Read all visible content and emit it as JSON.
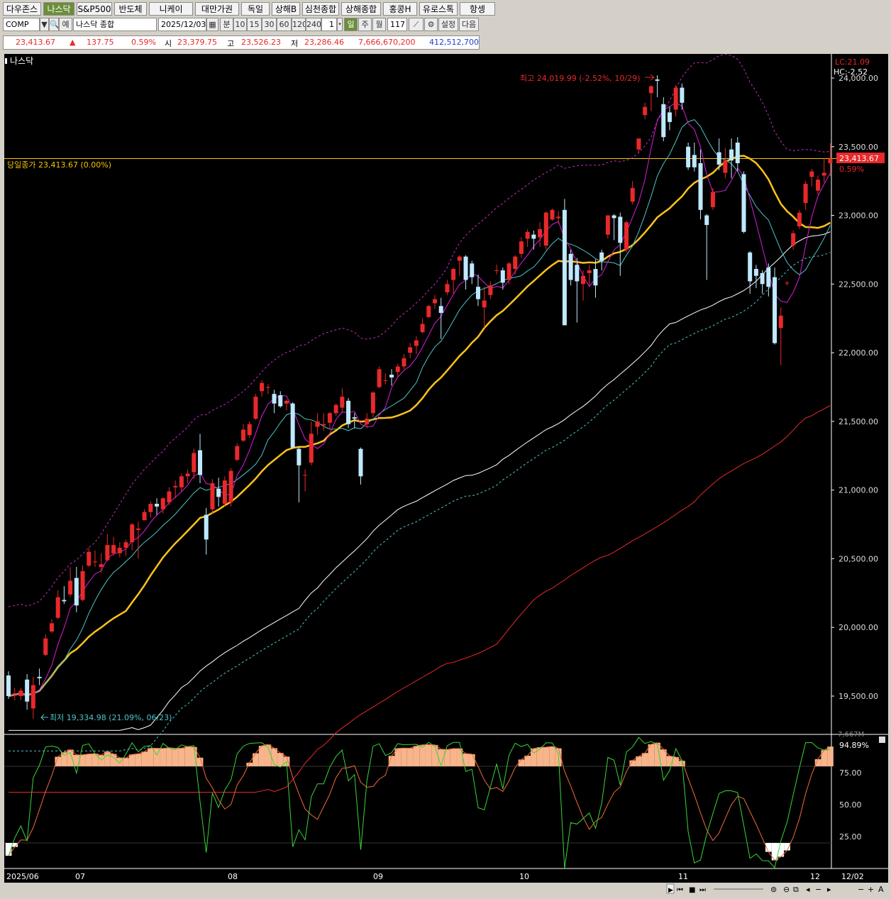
{
  "tabs": [
    {
      "label": "다우존스",
      "active": false
    },
    {
      "label": "나스닥",
      "active": true
    },
    {
      "label": "S&P500",
      "active": false
    },
    {
      "label": "반도체",
      "active": false
    },
    {
      "label": "니케이",
      "active": false
    },
    {
      "label": "대만가권",
      "active": false
    },
    {
      "label": "독일",
      "active": false
    },
    {
      "label": "상해B",
      "active": false
    },
    {
      "label": "심천종합",
      "active": false
    },
    {
      "label": "상해종합",
      "active": false
    },
    {
      "label": "홍콩H",
      "active": false
    },
    {
      "label": "유로스톡",
      "active": false
    },
    {
      "label": "항셍",
      "active": false
    }
  ],
  "toolbar": {
    "symbol": "COMP",
    "name": "나스닥 종합",
    "date": "2025/12/03",
    "period_buttons": [
      "분",
      "10",
      "15",
      "30",
      "60",
      "120",
      "240"
    ],
    "count": "1",
    "selected_period": "일",
    "week": "주",
    "month": "월",
    "bars": "117",
    "settings": "설정",
    "next": "다음"
  },
  "quote": {
    "close": "23,413.67",
    "change_arrow": "▲",
    "change": "137.75",
    "change_pct": "0.59%",
    "open_label": "시",
    "open": "23,379.75",
    "high_label": "고",
    "high": "23,526.23",
    "low_label": "저",
    "low": "23,286.46",
    "amount": "7,666,670,200",
    "volume": "412,512,700"
  },
  "chart": {
    "name": "나스닥",
    "y_axis": [
      "24,000.00",
      "23,500.00",
      "23,000.00",
      "22,500.00",
      "22,000.00",
      "21,500.00",
      "21,000.00",
      "20,500.00",
      "20,000.00",
      "19,500.00"
    ],
    "lc_label": "LC:21.09",
    "hc_label": "HC:-2.52",
    "prev_close_label": "당일종가 23,413.67 (0.00%)",
    "price_tag": "23,413.67",
    "price_tag_pct": "0.59%",
    "high_annotation": "최고 24,019.99 (-2.52%, 10/29)",
    "low_annotation": "최저 19,334.98 (21.09%, 06/23)",
    "volume_max_label": "7,667M",
    "osc_value": "94.89%",
    "osc_axis": [
      "75.00",
      "50.00",
      "25.00"
    ],
    "x_labels": [
      "2025/06",
      "07",
      "08",
      "09",
      "10",
      "11",
      "12"
    ],
    "x_end_label": "12/02"
  },
  "colors": {
    "up": "#e8292b",
    "down": "#bfe9ff",
    "ma5": "#d81fd8",
    "ma10": "#4fc3c8",
    "ma20": "#ffc31a",
    "ma60": "#ffffff",
    "ma120": "#e8292b",
    "band": "#c22fc2",
    "fast": "#39d539",
    "slow": "#f26a3c"
  },
  "chart_data": {
    "type": "candlestick",
    "title": "나스닥",
    "ylim": [
      19200,
      24350
    ],
    "candles": [
      {
        "o": 19650,
        "h": 19680,
        "l": 19480,
        "c": 19500
      },
      {
        "o": 19520,
        "h": 19560,
        "l": 19470,
        "c": 19520
      },
      {
        "o": 19500,
        "h": 19560,
        "l": 19470,
        "c": 19540
      },
      {
        "o": 19620,
        "h": 19660,
        "l": 19400,
        "c": 19460
      },
      {
        "o": 19410,
        "h": 19640,
        "l": 19334.98,
        "c": 19580
      },
      {
        "o": 19640,
        "h": 19700,
        "l": 19580,
        "c": 19630
      },
      {
        "o": 19800,
        "h": 19950,
        "l": 19790,
        "c": 19920
      },
      {
        "o": 19970,
        "h": 20060,
        "l": 19960,
        "c": 20030
      },
      {
        "o": 20070,
        "h": 20270,
        "l": 20060,
        "c": 20220
      },
      {
        "o": 20200,
        "h": 20300,
        "l": 20170,
        "c": 20190
      },
      {
        "o": 20240,
        "h": 20440,
        "l": 20220,
        "c": 20340
      },
      {
        "o": 20360,
        "h": 20440,
        "l": 20110,
        "c": 20160
      },
      {
        "o": 20200,
        "h": 20450,
        "l": 20190,
        "c": 20410
      },
      {
        "o": 20450,
        "h": 20580,
        "l": 20440,
        "c": 20550
      },
      {
        "o": 20480,
        "h": 20560,
        "l": 20440,
        "c": 20480
      },
      {
        "o": 20440,
        "h": 20540,
        "l": 20400,
        "c": 20460
      },
      {
        "o": 20490,
        "h": 20680,
        "l": 20480,
        "c": 20600
      },
      {
        "o": 20540,
        "h": 20660,
        "l": 20520,
        "c": 20600
      },
      {
        "o": 20540,
        "h": 20620,
        "l": 20510,
        "c": 20580
      },
      {
        "o": 20580,
        "h": 20640,
        "l": 20520,
        "c": 20620
      },
      {
        "o": 20620,
        "h": 20760,
        "l": 20560,
        "c": 20750
      },
      {
        "o": 20710,
        "h": 20770,
        "l": 20500,
        "c": 20720
      },
      {
        "o": 20780,
        "h": 20860,
        "l": 20780,
        "c": 20840
      },
      {
        "o": 20840,
        "h": 20920,
        "l": 20800,
        "c": 20900
      },
      {
        "o": 20900,
        "h": 20940,
        "l": 20820,
        "c": 20880
      },
      {
        "o": 20860,
        "h": 20950,
        "l": 20830,
        "c": 20940
      },
      {
        "o": 20910,
        "h": 21020,
        "l": 20890,
        "c": 20990
      },
      {
        "o": 21020,
        "h": 21070,
        "l": 20940,
        "c": 21030
      },
      {
        "o": 21020,
        "h": 21120,
        "l": 20990,
        "c": 21100
      },
      {
        "o": 21100,
        "h": 21150,
        "l": 21050,
        "c": 21120
      },
      {
        "o": 21130,
        "h": 21300,
        "l": 21080,
        "c": 21270
      },
      {
        "o": 21290,
        "h": 21410,
        "l": 21050,
        "c": 21110
      },
      {
        "o": 20820,
        "h": 20870,
        "l": 20530,
        "c": 20640
      },
      {
        "o": 20860,
        "h": 21080,
        "l": 20830,
        "c": 21050
      },
      {
        "o": 21010,
        "h": 21090,
        "l": 20880,
        "c": 20950
      },
      {
        "o": 20900,
        "h": 21100,
        "l": 20880,
        "c": 21070
      },
      {
        "o": 20910,
        "h": 21160,
        "l": 20880,
        "c": 21140
      },
      {
        "o": 21220,
        "h": 21340,
        "l": 21210,
        "c": 21320
      },
      {
        "o": 21360,
        "h": 21480,
        "l": 21350,
        "c": 21440
      },
      {
        "o": 21400,
        "h": 21500,
        "l": 21380,
        "c": 21480
      },
      {
        "o": 21520,
        "h": 21700,
        "l": 21510,
        "c": 21680
      },
      {
        "o": 21720,
        "h": 21800,
        "l": 21680,
        "c": 21780
      },
      {
        "o": 21750,
        "h": 21770,
        "l": 21700,
        "c": 21750
      },
      {
        "o": 21700,
        "h": 21730,
        "l": 21560,
        "c": 21630
      },
      {
        "o": 21690,
        "h": 21720,
        "l": 21600,
        "c": 21610
      },
      {
        "o": 21630,
        "h": 21660,
        "l": 21580,
        "c": 21650
      },
      {
        "o": 21630,
        "h": 21640,
        "l": 21300,
        "c": 21310
      },
      {
        "o": 21300,
        "h": 21320,
        "l": 20910,
        "c": 21180
      },
      {
        "o": 21110,
        "h": 21150,
        "l": 20990,
        "c": 21110
      },
      {
        "o": 21200,
        "h": 21500,
        "l": 21180,
        "c": 21410
      },
      {
        "o": 21460,
        "h": 21560,
        "l": 21400,
        "c": 21500
      },
      {
        "o": 21470,
        "h": 21560,
        "l": 21430,
        "c": 21480
      },
      {
        "o": 21490,
        "h": 21570,
        "l": 21440,
        "c": 21560
      },
      {
        "o": 21560,
        "h": 21630,
        "l": 21540,
        "c": 21620
      },
      {
        "o": 21600,
        "h": 21740,
        "l": 21560,
        "c": 21680
      },
      {
        "o": 21650,
        "h": 21670,
        "l": 21450,
        "c": 21480
      },
      {
        "o": 21530,
        "h": 21560,
        "l": 21450,
        "c": 21520
      },
      {
        "o": 21300,
        "h": 21310,
        "l": 21040,
        "c": 21100
      },
      {
        "o": 21480,
        "h": 21560,
        "l": 21450,
        "c": 21520
      },
      {
        "o": 21560,
        "h": 21720,
        "l": 21530,
        "c": 21710
      },
      {
        "o": 21750,
        "h": 21900,
        "l": 21740,
        "c": 21880
      },
      {
        "o": 21800,
        "h": 21850,
        "l": 21770,
        "c": 21800
      },
      {
        "o": 21840,
        "h": 21880,
        "l": 21760,
        "c": 21820
      },
      {
        "o": 21860,
        "h": 21920,
        "l": 21820,
        "c": 21900
      },
      {
        "o": 21900,
        "h": 21990,
        "l": 21880,
        "c": 21960
      },
      {
        "o": 22000,
        "h": 22070,
        "l": 21960,
        "c": 22040
      },
      {
        "o": 22050,
        "h": 22120,
        "l": 21990,
        "c": 22090
      },
      {
        "o": 22150,
        "h": 22250,
        "l": 22140,
        "c": 22210
      },
      {
        "o": 22260,
        "h": 22350,
        "l": 22250,
        "c": 22340
      },
      {
        "o": 22360,
        "h": 22420,
        "l": 22320,
        "c": 22390
      },
      {
        "o": 22340,
        "h": 22400,
        "l": 22100,
        "c": 22290
      },
      {
        "o": 22440,
        "h": 22530,
        "l": 22420,
        "c": 22500
      },
      {
        "o": 22530,
        "h": 22620,
        "l": 22430,
        "c": 22610
      },
      {
        "o": 22670,
        "h": 22710,
        "l": 22560,
        "c": 22700
      },
      {
        "o": 22700,
        "h": 22710,
        "l": 22460,
        "c": 22530
      },
      {
        "o": 22650,
        "h": 22670,
        "l": 22500,
        "c": 22550
      },
      {
        "o": 22480,
        "h": 22570,
        "l": 22340,
        "c": 22390
      },
      {
        "o": 22330,
        "h": 22480,
        "l": 22180,
        "c": 22380
      },
      {
        "o": 22420,
        "h": 22520,
        "l": 22390,
        "c": 22490
      },
      {
        "o": 22600,
        "h": 22640,
        "l": 22570,
        "c": 22600
      },
      {
        "o": 22600,
        "h": 22620,
        "l": 22460,
        "c": 22510
      },
      {
        "o": 22530,
        "h": 22660,
        "l": 22500,
        "c": 22650
      },
      {
        "o": 22610,
        "h": 22710,
        "l": 22570,
        "c": 22700
      },
      {
        "o": 22720,
        "h": 22840,
        "l": 22690,
        "c": 22810
      },
      {
        "o": 22830,
        "h": 22900,
        "l": 22770,
        "c": 22880
      },
      {
        "o": 22860,
        "h": 22890,
        "l": 22750,
        "c": 22830
      },
      {
        "o": 22840,
        "h": 22950,
        "l": 22770,
        "c": 22900
      },
      {
        "o": 22780,
        "h": 23030,
        "l": 22750,
        "c": 23020
      },
      {
        "o": 22970,
        "h": 23050,
        "l": 22960,
        "c": 23040
      },
      {
        "o": 22980,
        "h": 23030,
        "l": 22940,
        "c": 22990
      },
      {
        "o": 23040,
        "h": 23120,
        "l": 22200,
        "c": 22200
      },
      {
        "o": 22720,
        "h": 22750,
        "l": 22490,
        "c": 22530
      },
      {
        "o": 22640,
        "h": 22690,
        "l": 22220,
        "c": 22520
      },
      {
        "o": 22500,
        "h": 22600,
        "l": 22380,
        "c": 22560
      },
      {
        "o": 22580,
        "h": 22640,
        "l": 22490,
        "c": 22600
      },
      {
        "o": 22610,
        "h": 22680,
        "l": 22400,
        "c": 22490
      },
      {
        "o": 22730,
        "h": 22750,
        "l": 22600,
        "c": 22670
      },
      {
        "o": 22860,
        "h": 23000,
        "l": 22830,
        "c": 23000
      },
      {
        "o": 23000,
        "h": 23010,
        "l": 22820,
        "c": 22980
      },
      {
        "o": 22990,
        "h": 23020,
        "l": 22560,
        "c": 22800
      },
      {
        "o": 22750,
        "h": 22960,
        "l": 22730,
        "c": 22950
      },
      {
        "o": 23100,
        "h": 23250,
        "l": 23080,
        "c": 23200
      },
      {
        "o": 23480,
        "h": 23530,
        "l": 23460,
        "c": 23560
      },
      {
        "o": 23730,
        "h": 23820,
        "l": 23700,
        "c": 23790
      },
      {
        "o": 23890,
        "h": 23950,
        "l": 23760,
        "c": 23940
      },
      {
        "o": 23990,
        "h": 24019.99,
        "l": 23860,
        "c": 23980
      },
      {
        "o": 23810,
        "h": 23860,
        "l": 23540,
        "c": 23570
      },
      {
        "o": 23750,
        "h": 23790,
        "l": 23620,
        "c": 23680
      },
      {
        "o": 23770,
        "h": 23950,
        "l": 23720,
        "c": 23930
      },
      {
        "o": 23930,
        "h": 23960,
        "l": 23770,
        "c": 23820
      },
      {
        "o": 23500,
        "h": 23530,
        "l": 23330,
        "c": 23350
      },
      {
        "o": 23440,
        "h": 23530,
        "l": 23320,
        "c": 23350
      },
      {
        "o": 23380,
        "h": 23480,
        "l": 22970,
        "c": 23040
      },
      {
        "o": 23000,
        "h": 23010,
        "l": 22530,
        "c": 22930
      },
      {
        "o": 23060,
        "h": 23200,
        "l": 23040,
        "c": 23170
      },
      {
        "o": 23460,
        "h": 23560,
        "l": 23330,
        "c": 23370
      },
      {
        "o": 23310,
        "h": 23490,
        "l": 23270,
        "c": 23400
      },
      {
        "o": 23480,
        "h": 23560,
        "l": 23270,
        "c": 23400
      },
      {
        "o": 23530,
        "h": 23570,
        "l": 23320,
        "c": 23380
      },
      {
        "o": 23300,
        "h": 23320,
        "l": 22870,
        "c": 22880
      },
      {
        "o": 22730,
        "h": 22740,
        "l": 22430,
        "c": 22520
      },
      {
        "o": 22610,
        "h": 22640,
        "l": 22470,
        "c": 22560
      },
      {
        "o": 22580,
        "h": 22600,
        "l": 22430,
        "c": 22500
      },
      {
        "o": 22620,
        "h": 22650,
        "l": 22410,
        "c": 22480
      },
      {
        "o": 22550,
        "h": 22620,
        "l": 22060,
        "c": 22070
      },
      {
        "o": 22180,
        "h": 22330,
        "l": 21910,
        "c": 22270
      },
      {
        "o": 22510,
        "h": 22520,
        "l": 22490,
        "c": 22510
      },
      {
        "o": 22780,
        "h": 22890,
        "l": 22750,
        "c": 22870
      },
      {
        "o": 22920,
        "h": 23040,
        "l": 22900,
        "c": 23020
      },
      {
        "o": 23090,
        "h": 23250,
        "l": 23040,
        "c": 23230
      },
      {
        "o": 23280,
        "h": 23340,
        "l": 23210,
        "c": 23320
      },
      {
        "o": 23180,
        "h": 23290,
        "l": 23150,
        "c": 23260
      },
      {
        "o": 23290,
        "h": 23420,
        "l": 23240,
        "c": 23310
      },
      {
        "o": 23379.75,
        "h": 23526.23,
        "l": 23286.46,
        "c": 23413.67
      }
    ]
  }
}
